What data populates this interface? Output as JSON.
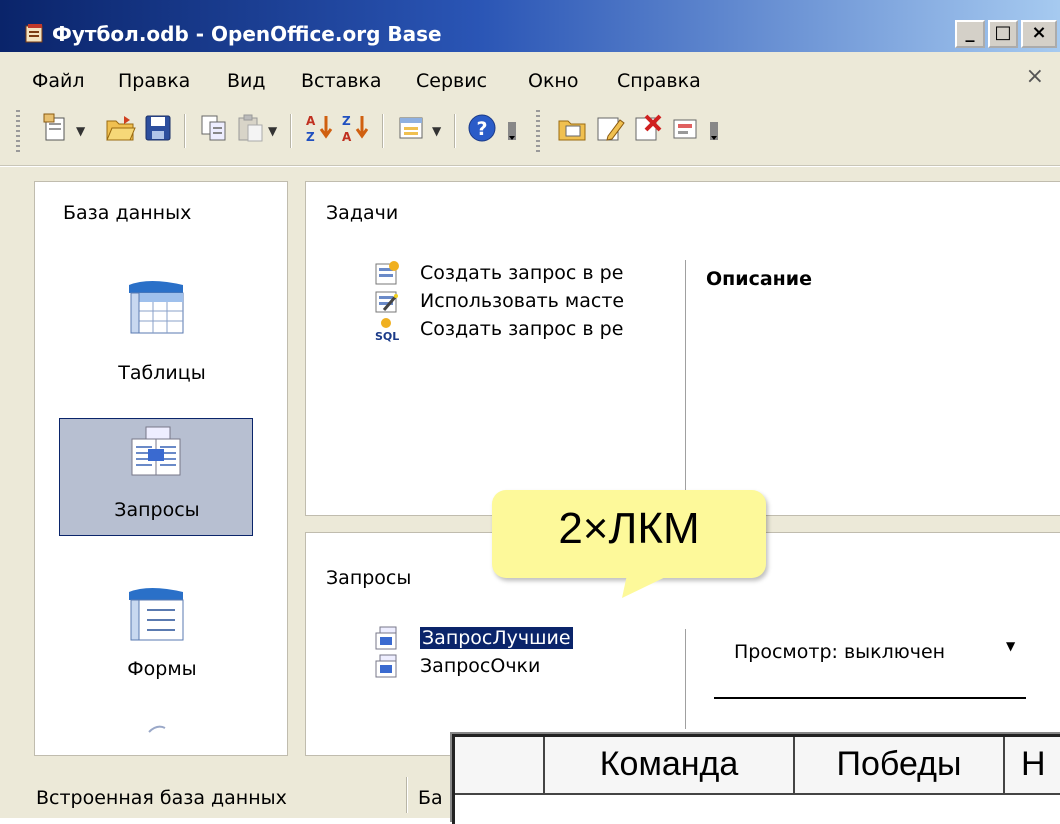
{
  "window": {
    "title": "Футбол.odb - OpenOffice.org Base",
    "controls": {
      "minimize": "_",
      "maximize": "□",
      "close": "×"
    }
  },
  "menubar": {
    "items": [
      "Файл",
      "Правка",
      "Вид",
      "Вставка",
      "Сервис",
      "Окно",
      "Справка"
    ],
    "doc_close": "×"
  },
  "toolbar": {
    "icons": [
      "new-document-icon",
      "open-folder-icon",
      "save-icon",
      "copy-icon",
      "paste-icon",
      "sort-ascending-icon",
      "sort-descending-icon",
      "form-icon",
      "help-icon",
      "open-object-icon",
      "edit-object-icon",
      "delete-object-icon",
      "rename-object-icon"
    ]
  },
  "left_panel": {
    "title": "База данных",
    "categories": [
      {
        "label": "Таблицы",
        "icon": "tables-icon",
        "selected": false
      },
      {
        "label": "Запросы",
        "icon": "queries-icon",
        "selected": true
      },
      {
        "label": "Формы",
        "icon": "forms-icon",
        "selected": false
      }
    ]
  },
  "tasks": {
    "title": "Задачи",
    "items": [
      {
        "label": "Создать запрос в ре",
        "icon": "design-query-icon"
      },
      {
        "label": "Использовать масте",
        "icon": "wizard-icon"
      },
      {
        "label": "Создать запрос в ре",
        "icon": "sql-icon"
      }
    ],
    "description_title": "Описание"
  },
  "queries": {
    "title": "Запросы",
    "items": [
      {
        "label": "ЗапросЛучшие",
        "selected": true
      },
      {
        "label": "ЗапросОчки",
        "selected": false
      }
    ],
    "preview_label": "Просмотр: выключен"
  },
  "status_bar": {
    "left": "Встроенная база данных",
    "right": "Ба"
  },
  "callout": {
    "text": "2×ЛКМ",
    "color": "#fdf99a"
  },
  "result_table": {
    "columns": [
      "Команда",
      "Победы",
      "Н"
    ]
  }
}
